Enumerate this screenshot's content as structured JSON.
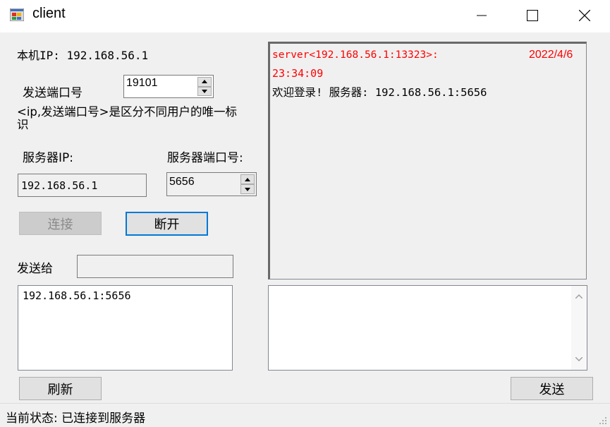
{
  "window": {
    "title": "client",
    "minimize_icon": "minimize-icon",
    "maximize_icon": "maximize-icon",
    "close_icon": "close-icon"
  },
  "form": {
    "local_ip_label": "本机IP: 192.168.56.1",
    "send_port_label": "发送端口号",
    "send_port_value": "19101",
    "note": "<ip,发送端口号>是区分不同用户的唯一标识",
    "server_ip_label": "服务器IP:",
    "server_ip_value": "192.168.56.1",
    "server_port_label": "服务器端口号:",
    "server_port_value": "5656",
    "connect_button": "连接",
    "disconnect_button": "断开",
    "send_to_label": "发送给",
    "send_to_value": "",
    "recipients": [
      "192.168.56.1:5656"
    ],
    "refresh_button": "刷新",
    "send_button": "发送"
  },
  "log": {
    "header": "server<192.168.56.1:13323>:",
    "date": "2022/4/6",
    "time": "23:34:09",
    "message": "欢迎登录! 服务器: 192.168.56.1:5656",
    "header_color": "#ff0000"
  },
  "message_input": {
    "value": ""
  },
  "status": {
    "text": "当前状态: 已连接到服务器"
  }
}
